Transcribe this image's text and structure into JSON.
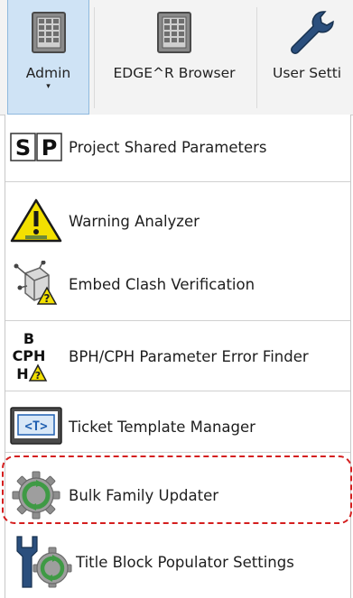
{
  "ribbon": {
    "buttons": [
      {
        "label": "Admin",
        "caret": "▾",
        "icon": "panel-grid-icon",
        "active": true
      },
      {
        "label": "EDGE^R Browser",
        "icon": "panel-grid-icon",
        "active": false
      },
      {
        "label": "User Setti",
        "icon": "wrench-icon",
        "active": false
      }
    ]
  },
  "menu": {
    "items": [
      {
        "label": "Project Shared Parameters",
        "icon": "sp-icon",
        "icon_text": [
          "S",
          "P"
        ]
      },
      {
        "label": "Warning Analyzer",
        "icon": "warning-icon"
      },
      {
        "label": "Embed Clash Verification",
        "icon": "embed-clash-icon"
      },
      {
        "label": "BPH/CPH Parameter Error Finder",
        "icon": "bph-cph-icon",
        "icon_text": [
          "B",
          "CPH",
          "H"
        ]
      },
      {
        "label": "Ticket Template Manager",
        "icon": "ticket-template-icon",
        "icon_text": [
          "<T>"
        ]
      },
      {
        "label": "Bulk Family Updater",
        "icon": "gear-refresh-icon"
      },
      {
        "label": "Title Block Populator Settings",
        "icon": "wrench-gear-icon"
      }
    ]
  },
  "colors": {
    "active_tab": "#cfe3f5",
    "highlight": "#d41e1e",
    "gear_green": "#3f9a45",
    "warning_yellow": "#f3e000"
  }
}
